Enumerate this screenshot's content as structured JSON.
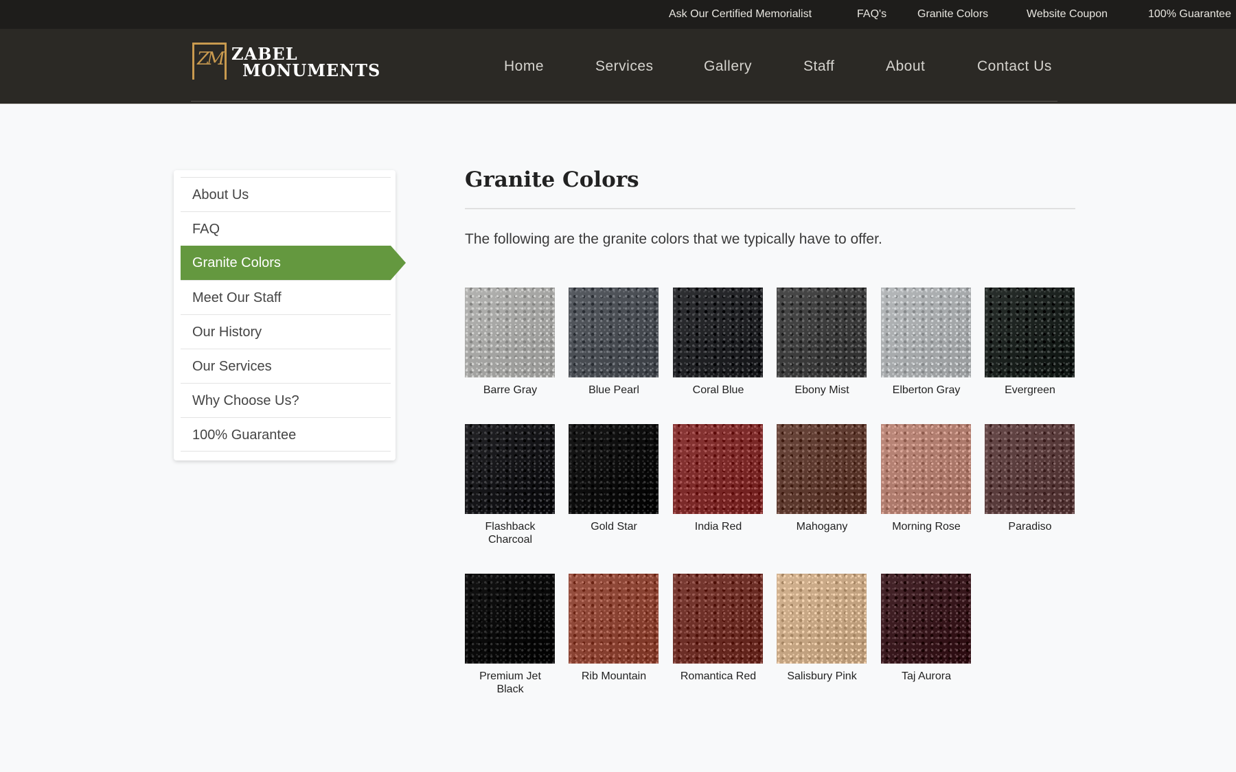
{
  "utility_nav": [
    "Ask Our Certified Memorialist",
    "FAQ's",
    "Granite Colors",
    "Website Coupon",
    "100% Guarantee"
  ],
  "logo": {
    "line1": "ZABEL",
    "line2": "MONUMENTS",
    "mark": "ZM",
    "accent": "#c99a4f"
  },
  "main_nav": [
    "Home",
    "Services",
    "Gallery",
    "Staff",
    "About",
    "Contact Us"
  ],
  "sidebar": {
    "items": [
      "About Us",
      "FAQ",
      "Granite Colors",
      "Meet Our Staff",
      "Our History",
      "Our Services",
      "Why Choose Us?",
      "100% Guarantee"
    ],
    "active": "Granite Colors",
    "active_color": "#64983f"
  },
  "page": {
    "title": "Granite Colors",
    "intro": "The following are the granite colors that we typically have to offer."
  },
  "granites": [
    {
      "name": "Barre Gray",
      "color": "#a7a7a5"
    },
    {
      "name": "Blue Pearl",
      "color": "#4b4f55"
    },
    {
      "name": "Coral Blue",
      "color": "#232427"
    },
    {
      "name": "Ebony Mist",
      "color": "#3e3e3e"
    },
    {
      "name": "Elberton Gray",
      "color": "#a9acae"
    },
    {
      "name": "Evergreen",
      "color": "#1d2320"
    },
    {
      "name": "Flashback Charcoal",
      "color": "#17171a"
    },
    {
      "name": "Gold Star",
      "color": "#0b0b0b"
    },
    {
      "name": "India Red",
      "color": "#7e2c2b"
    },
    {
      "name": "Mahogany",
      "color": "#5e3b30"
    },
    {
      "name": "Morning Rose",
      "color": "#b07d6f"
    },
    {
      "name": "Paradiso",
      "color": "#5a3d3d"
    },
    {
      "name": "Premium Jet Black",
      "color": "#060606"
    },
    {
      "name": "Rib Mountain",
      "color": "#8c4535"
    },
    {
      "name": "Romantica Red",
      "color": "#6e3028"
    },
    {
      "name": "Salisbury Pink",
      "color": "#c7a785"
    },
    {
      "name": "Taj Aurora",
      "color": "#3a1a1f"
    }
  ]
}
